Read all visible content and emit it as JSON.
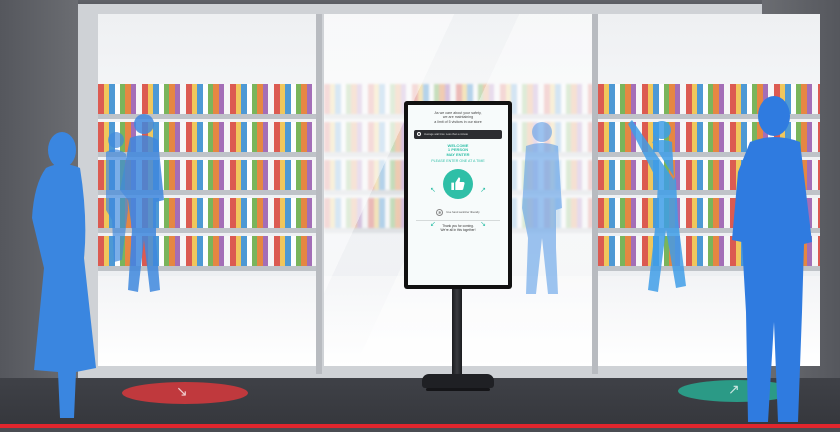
{
  "kiosk": {
    "notice_lines": [
      "As we care about your safety,",
      "we are maintaining",
      "a limit of 5 visitors in our store"
    ],
    "bar_text": "Average wait time: Less than a minute",
    "welcome_lines": [
      "WELCOME",
      "1 PERSON",
      "MAY ENTER"
    ],
    "please_text": "PLEASE ENTER ONE AT A TIME",
    "thumbs_icon": "thumbs-up-icon",
    "sanitizer_text": "Use hand sanitizer liberally",
    "thanks_lines": [
      "Thank you for coming.",
      "We're all in this together!"
    ],
    "accent_color": "#2fbfa7"
  },
  "colors": {
    "silhouette": "#3a86e0",
    "floor_red": "#c0393d",
    "floor_green": "#2b9a86",
    "bottom_line": "#e0262d"
  }
}
